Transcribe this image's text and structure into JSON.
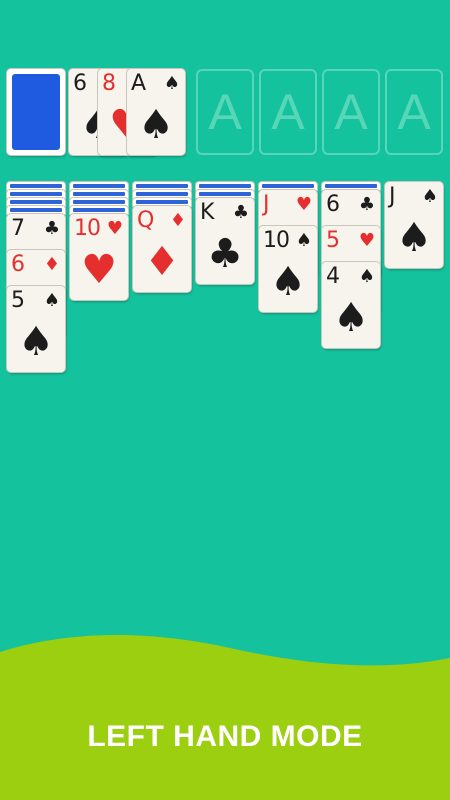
{
  "colors": {
    "background": "#14c29e",
    "wave": "#9ccf0f",
    "card_red": "#e52f2f",
    "card_black": "#1c1c1c",
    "card_back": "#1f5be0"
  },
  "stock": {
    "label": "stock"
  },
  "waste": [
    {
      "rank": "6",
      "suit": "♠",
      "color": "black"
    },
    {
      "rank": "8",
      "suit": "♥",
      "color": "red"
    },
    {
      "rank": "A",
      "suit": "♠",
      "color": "black"
    }
  ],
  "foundations": [
    "A",
    "A",
    "A",
    "A"
  ],
  "tableau": [
    {
      "facedown": 4,
      "cards": [
        {
          "rank": "7",
          "suit": "♣",
          "color": "black"
        },
        {
          "rank": "6",
          "suit": "♦",
          "color": "red"
        },
        {
          "rank": "5",
          "suit": "♠",
          "color": "black"
        }
      ]
    },
    {
      "facedown": 4,
      "cards": [
        {
          "rank": "10",
          "suit": "♥",
          "color": "red"
        }
      ]
    },
    {
      "facedown": 3,
      "cards": [
        {
          "rank": "Q",
          "suit": "♦",
          "color": "red"
        }
      ]
    },
    {
      "facedown": 2,
      "cards": [
        {
          "rank": "K",
          "suit": "♣",
          "color": "black"
        }
      ]
    },
    {
      "facedown": 1,
      "cards": [
        {
          "rank": "J",
          "suit": "♥",
          "color": "red"
        },
        {
          "rank": "10",
          "suit": "♠",
          "color": "black"
        }
      ]
    },
    {
      "facedown": 1,
      "cards": [
        {
          "rank": "6",
          "suit": "♣",
          "color": "black"
        },
        {
          "rank": "5",
          "suit": "♥",
          "color": "red"
        },
        {
          "rank": "4",
          "suit": "♠",
          "color": "black"
        }
      ]
    },
    {
      "facedown": 0,
      "cards": [
        {
          "rank": "J",
          "suit": "♠",
          "color": "black"
        }
      ]
    }
  ],
  "footer": {
    "mode_label": "LEFT HAND MODE"
  }
}
